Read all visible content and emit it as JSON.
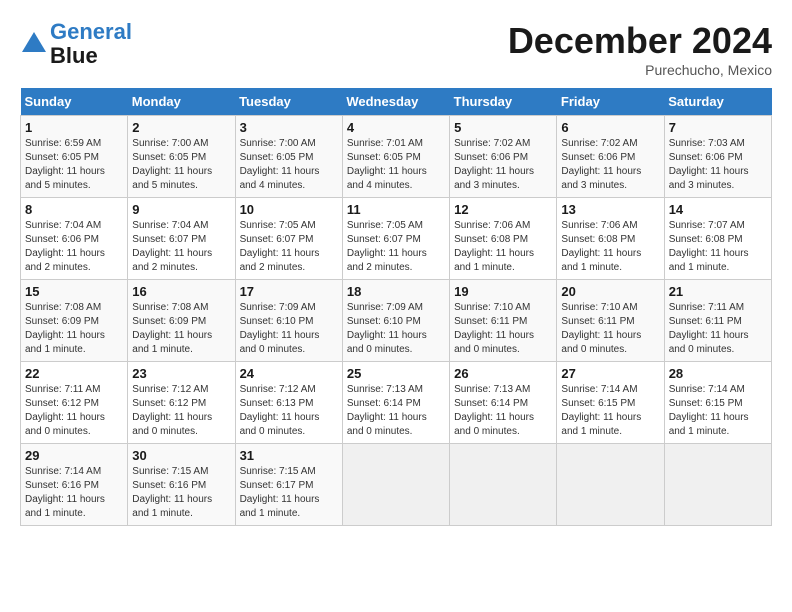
{
  "logo": {
    "line1": "General",
    "line2": "Blue"
  },
  "title": "December 2024",
  "subtitle": "Purechucho, Mexico",
  "headers": [
    "Sunday",
    "Monday",
    "Tuesday",
    "Wednesday",
    "Thursday",
    "Friday",
    "Saturday"
  ],
  "weeks": [
    [
      {
        "day": "1",
        "sunrise": "6:59 AM",
        "sunset": "6:05 PM",
        "daylight": "11 hours and 5 minutes."
      },
      {
        "day": "2",
        "sunrise": "7:00 AM",
        "sunset": "6:05 PM",
        "daylight": "11 hours and 5 minutes."
      },
      {
        "day": "3",
        "sunrise": "7:00 AM",
        "sunset": "6:05 PM",
        "daylight": "11 hours and 4 minutes."
      },
      {
        "day": "4",
        "sunrise": "7:01 AM",
        "sunset": "6:05 PM",
        "daylight": "11 hours and 4 minutes."
      },
      {
        "day": "5",
        "sunrise": "7:02 AM",
        "sunset": "6:06 PM",
        "daylight": "11 hours and 3 minutes."
      },
      {
        "day": "6",
        "sunrise": "7:02 AM",
        "sunset": "6:06 PM",
        "daylight": "11 hours and 3 minutes."
      },
      {
        "day": "7",
        "sunrise": "7:03 AM",
        "sunset": "6:06 PM",
        "daylight": "11 hours and 3 minutes."
      }
    ],
    [
      {
        "day": "8",
        "sunrise": "7:04 AM",
        "sunset": "6:06 PM",
        "daylight": "11 hours and 2 minutes."
      },
      {
        "day": "9",
        "sunrise": "7:04 AM",
        "sunset": "6:07 PM",
        "daylight": "11 hours and 2 minutes."
      },
      {
        "day": "10",
        "sunrise": "7:05 AM",
        "sunset": "6:07 PM",
        "daylight": "11 hours and 2 minutes."
      },
      {
        "day": "11",
        "sunrise": "7:05 AM",
        "sunset": "6:07 PM",
        "daylight": "11 hours and 2 minutes."
      },
      {
        "day": "12",
        "sunrise": "7:06 AM",
        "sunset": "6:08 PM",
        "daylight": "11 hours and 1 minute."
      },
      {
        "day": "13",
        "sunrise": "7:06 AM",
        "sunset": "6:08 PM",
        "daylight": "11 hours and 1 minute."
      },
      {
        "day": "14",
        "sunrise": "7:07 AM",
        "sunset": "6:08 PM",
        "daylight": "11 hours and 1 minute."
      }
    ],
    [
      {
        "day": "15",
        "sunrise": "7:08 AM",
        "sunset": "6:09 PM",
        "daylight": "11 hours and 1 minute."
      },
      {
        "day": "16",
        "sunrise": "7:08 AM",
        "sunset": "6:09 PM",
        "daylight": "11 hours and 1 minute."
      },
      {
        "day": "17",
        "sunrise": "7:09 AM",
        "sunset": "6:10 PM",
        "daylight": "11 hours and 0 minutes."
      },
      {
        "day": "18",
        "sunrise": "7:09 AM",
        "sunset": "6:10 PM",
        "daylight": "11 hours and 0 minutes."
      },
      {
        "day": "19",
        "sunrise": "7:10 AM",
        "sunset": "6:11 PM",
        "daylight": "11 hours and 0 minutes."
      },
      {
        "day": "20",
        "sunrise": "7:10 AM",
        "sunset": "6:11 PM",
        "daylight": "11 hours and 0 minutes."
      },
      {
        "day": "21",
        "sunrise": "7:11 AM",
        "sunset": "6:11 PM",
        "daylight": "11 hours and 0 minutes."
      }
    ],
    [
      {
        "day": "22",
        "sunrise": "7:11 AM",
        "sunset": "6:12 PM",
        "daylight": "11 hours and 0 minutes."
      },
      {
        "day": "23",
        "sunrise": "7:12 AM",
        "sunset": "6:12 PM",
        "daylight": "11 hours and 0 minutes."
      },
      {
        "day": "24",
        "sunrise": "7:12 AM",
        "sunset": "6:13 PM",
        "daylight": "11 hours and 0 minutes."
      },
      {
        "day": "25",
        "sunrise": "7:13 AM",
        "sunset": "6:14 PM",
        "daylight": "11 hours and 0 minutes."
      },
      {
        "day": "26",
        "sunrise": "7:13 AM",
        "sunset": "6:14 PM",
        "daylight": "11 hours and 0 minutes."
      },
      {
        "day": "27",
        "sunrise": "7:14 AM",
        "sunset": "6:15 PM",
        "daylight": "11 hours and 1 minute."
      },
      {
        "day": "28",
        "sunrise": "7:14 AM",
        "sunset": "6:15 PM",
        "daylight": "11 hours and 1 minute."
      }
    ],
    [
      {
        "day": "29",
        "sunrise": "7:14 AM",
        "sunset": "6:16 PM",
        "daylight": "11 hours and 1 minute."
      },
      {
        "day": "30",
        "sunrise": "7:15 AM",
        "sunset": "6:16 PM",
        "daylight": "11 hours and 1 minute."
      },
      {
        "day": "31",
        "sunrise": "7:15 AM",
        "sunset": "6:17 PM",
        "daylight": "11 hours and 1 minute."
      },
      null,
      null,
      null,
      null
    ]
  ]
}
